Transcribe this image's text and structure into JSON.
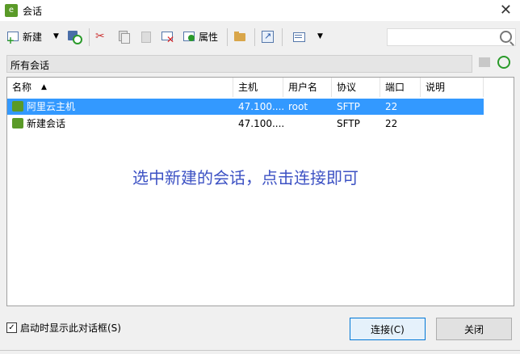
{
  "window": {
    "title": "会话",
    "app_icon_text": "e"
  },
  "toolbar": {
    "new_label": "新建",
    "properties_label": "属性"
  },
  "path": "所有会话",
  "table": {
    "columns": [
      "名称",
      "主机",
      "用户名",
      "协议",
      "端口",
      "说明"
    ],
    "rows": [
      {
        "name": "阿里云主机",
        "host": "47.100....",
        "user": "root",
        "protocol": "SFTP",
        "port": "22",
        "desc": "",
        "selected": true
      },
      {
        "name": "新建会话",
        "host": "47.100....",
        "user": "",
        "protocol": "SFTP",
        "port": "22",
        "desc": "",
        "selected": false
      }
    ]
  },
  "hint_text": "选中新建的会话，点击连接即可",
  "footer": {
    "checkbox_label": "启动时显示此对话框(S)",
    "checked": true,
    "connect_label": "连接(C)",
    "close_label": "关闭"
  }
}
